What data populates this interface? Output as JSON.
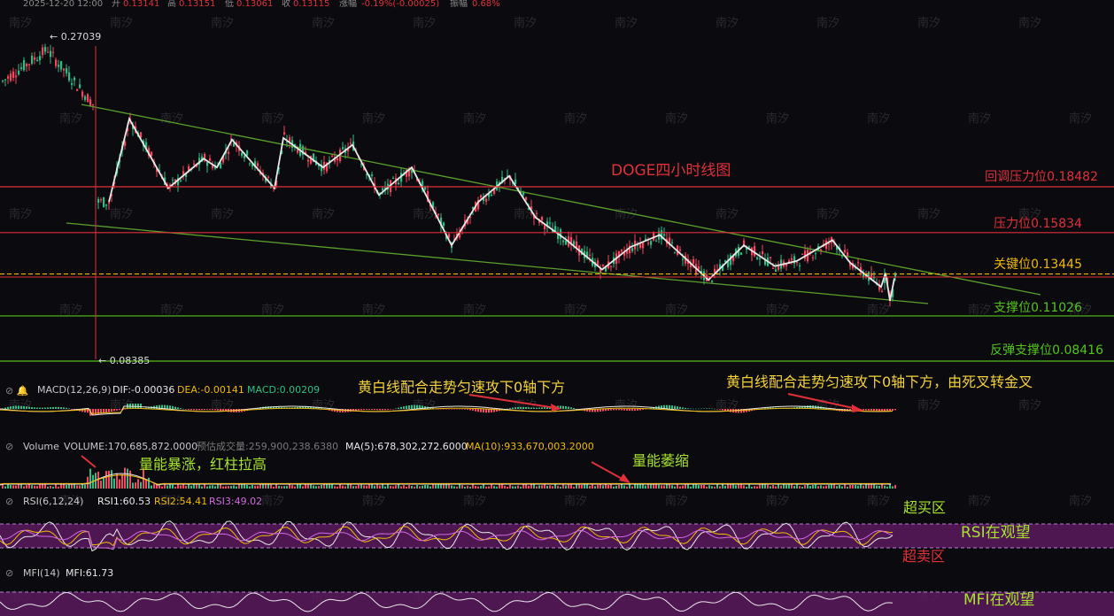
{
  "header": {
    "date": "2025-12-20 12:00",
    "open_label": "开",
    "open": "0.13141",
    "high_label": "高",
    "high": "0.13151",
    "low_label": "低",
    "low": "0.13061",
    "close_label": "收",
    "close": "0.13115",
    "change_label": "涨幅",
    "change": "-0.19%(-0.00025)",
    "amp_label": "振幅",
    "amp": "0.68%"
  },
  "watermark": "南汐",
  "colors": {
    "bg": "#0b0b0f",
    "up": "#2ebd85",
    "down": "#f6465d",
    "resistance": "#e0303a",
    "support": "#52c41a",
    "key": "#f0b90b",
    "channel": "#5aa02c",
    "zigzag": "#e8e8e8",
    "annotation_yellow": "#f3d23a",
    "annotation_green": "#a6e22e",
    "rsi_band": "#5a1a5e"
  },
  "chart_data": {
    "type": "candlestick",
    "title": "DOGE四小时线图",
    "price_extremes": {
      "high": "0.27039",
      "low": "0.08385"
    },
    "levels": [
      {
        "label": "回调压力位0.18482",
        "value": 0.18482,
        "kind": "resistance"
      },
      {
        "label": "压力位0.15834",
        "value": 0.15834,
        "kind": "resistance"
      },
      {
        "label": "关键位0.13445",
        "value": 0.13445,
        "kind": "key"
      },
      {
        "label": "支撑位0.11026",
        "value": 0.11026,
        "kind": "support"
      },
      {
        "label": "反弹支撑位0.08416",
        "value": 0.08416,
        "kind": "support"
      }
    ],
    "zigzag_prices": [
      0.176,
      0.224,
      0.184,
      0.201,
      0.196,
      0.212,
      0.184,
      0.213,
      0.196,
      0.209,
      0.18,
      0.196,
      0.151,
      0.176,
      0.191,
      0.167,
      0.154,
      0.137,
      0.15,
      0.157,
      0.143,
      0.131,
      0.151,
      0.139,
      0.142,
      0.154,
      0.141,
      0.135,
      0.127,
      0.135,
      0.119,
      0.132
    ],
    "macd": {
      "label": "MACD(12,26,9)",
      "dif": "DIF:-0.00036",
      "dea": "DEA:-0.00141",
      "macd": "MACD:0.00209"
    },
    "volume": {
      "label": "Volume",
      "volume": "VOLUME:170,685,872.0000",
      "est": "预估成交量:259,900,238.6380",
      "ma5": "MA(5):678,302,272.6000",
      "ma10": "MA(10):933,670,003.2000"
    },
    "rsi": {
      "label": "RSI(6,12,24)",
      "rsi1": "RSI1:60.53",
      "rsi2": "RSI2:54.41",
      "rsi3": "RSI3:49.02"
    },
    "mfi": {
      "label": "MFI(14)",
      "mfi": "MFI:61.73"
    }
  },
  "annotations": {
    "macd_note1": "黄白线配合走势匀速攻下0轴下方",
    "macd_note2": "黄白线配合走势匀速攻下0轴下方，由死叉转金叉",
    "vol_note1": "量能暴涨，红柱拉高",
    "vol_note2": "量能萎缩",
    "rsi_overbought": "超买区",
    "rsi_watch": "RSI在观望",
    "rsi_oversold": "超卖区",
    "mfi_watch": "MFI在观望"
  }
}
